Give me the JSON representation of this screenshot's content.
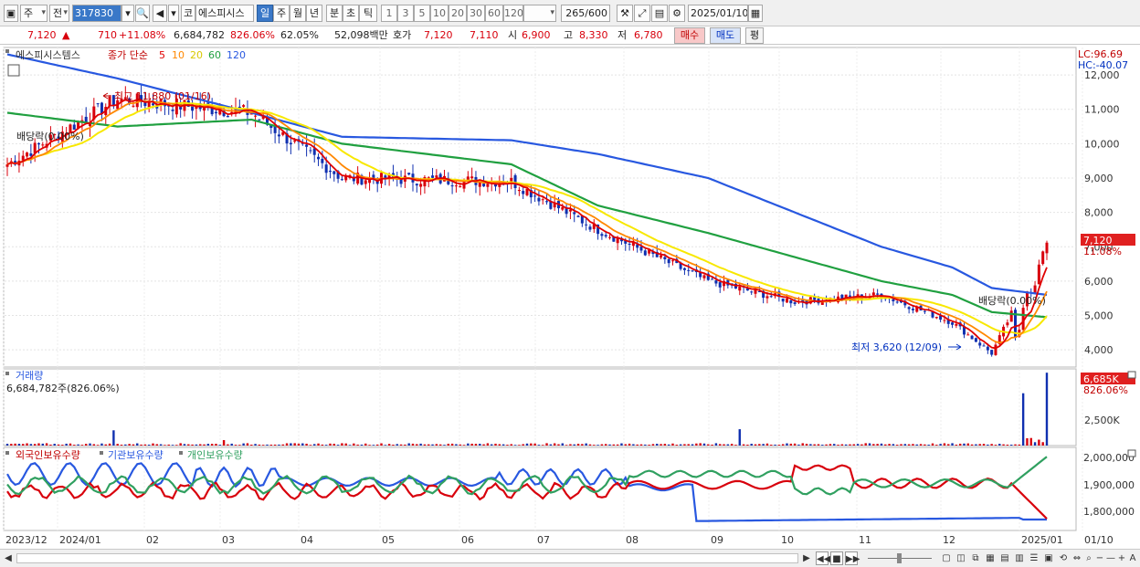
{
  "toolbar": {
    "type_sel": "주",
    "prev_label": "전",
    "code": "317830",
    "stock_prefix": "코",
    "stock_name": "에스피시스",
    "periods": [
      "일",
      "주",
      "월",
      "년",
      "분",
      "초",
      "틱"
    ],
    "intervals": [
      "1",
      "3",
      "5",
      "10",
      "20",
      "30",
      "60",
      "120"
    ],
    "count": "265",
    "count_total": "/600",
    "date": "2025/01/10"
  },
  "quote": {
    "price": "7,120",
    "direction": "▲",
    "change": "710",
    "change_pct": "+11.08%",
    "volume": "6,684,782",
    "volume_pct": "826.06%",
    "turnover": "62.05%",
    "amount": "52,098백만",
    "ask_label": "호가",
    "ask": "7,120",
    "bid": "7,110",
    "open_label": "시",
    "open": "6,900",
    "high_label": "고",
    "high": "8,330",
    "low_label": "저",
    "low": "6,780",
    "buy": "매수",
    "sell": "매도",
    "eval": "평"
  },
  "price_panel": {
    "stock_label": "에스피시스템스",
    "ma_label": "종가 단순",
    "ma_periods": [
      "5",
      "10",
      "20",
      "60",
      "120"
    ],
    "lc": "LC:96.69",
    "hc": "HC:-40.07",
    "high_annot": "최고 11,880 (01/16)",
    "low_annot": "최저 3,620 (12/09)",
    "ex_div_left": "배당락(0.00%)",
    "ex_div_right": "배당락(0.00%)",
    "current_price_tag": "7,120",
    "current_pct_tag": "11.08%",
    "y_ticks": [
      "12,000",
      "11,000",
      "10,000",
      "9,000",
      "8,000",
      "7,000",
      "6,000",
      "5,000",
      "4,000"
    ]
  },
  "volume_panel": {
    "title": "거래량",
    "value": "6,684,782주(826.06%)",
    "tag": "6,685K",
    "tag_pct": "826.06%",
    "y_ticks": [
      "2,500K"
    ]
  },
  "holding_panel": {
    "legend": [
      "외국인보유수량",
      "기관보유수량",
      "개인보유수량"
    ],
    "y_ticks": [
      "2,000,000",
      "1,900,000",
      "1,800,000"
    ]
  },
  "x_axis": [
    "2023/12",
    "2024/01",
    "02",
    "03",
    "04",
    "05",
    "06",
    "07",
    "08",
    "09",
    "10",
    "11",
    "12",
    "2025/01",
    "01/10"
  ],
  "colors": {
    "up": "#d8000c",
    "down": "#1030b0",
    "ma5": "#e00000",
    "ma10": "#ff8800",
    "ma20": "#f8e800",
    "ma60": "#20a040",
    "ma120": "#2858e0",
    "foreign": "#d8000c",
    "institution": "#2858e0",
    "individual": "#30a060"
  },
  "chart_data": {
    "type": "candlestick",
    "title": "",
    "x": [
      "2023-12",
      "2024-01-16",
      "2024-03",
      "2024-04",
      "2024-06",
      "2024-07",
      "2024-08",
      "2024-09",
      "2024-10",
      "2024-11",
      "2024-12-09",
      "2025-01-10"
    ],
    "close": [
      9400,
      11300,
      10900,
      9000,
      8900,
      7500,
      6000,
      5400,
      5600,
      4800,
      3900,
      7120
    ],
    "ma120": [
      12600,
      11900,
      10900,
      10200,
      10100,
      9700,
      9000,
      8000,
      7000,
      6400,
      5800,
      5600
    ],
    "ma60": [
      10900,
      10500,
      10700,
      10000,
      9400,
      8200,
      7400,
      6700,
      6000,
      5600,
      5100,
      4950
    ],
    "annotations": [
      "최고 11,880 (01/16)",
      "최저 3,620 (12/09)"
    ],
    "ylim": [
      3500,
      12800
    ],
    "volume_ylim": [
      0,
      6700000
    ]
  }
}
